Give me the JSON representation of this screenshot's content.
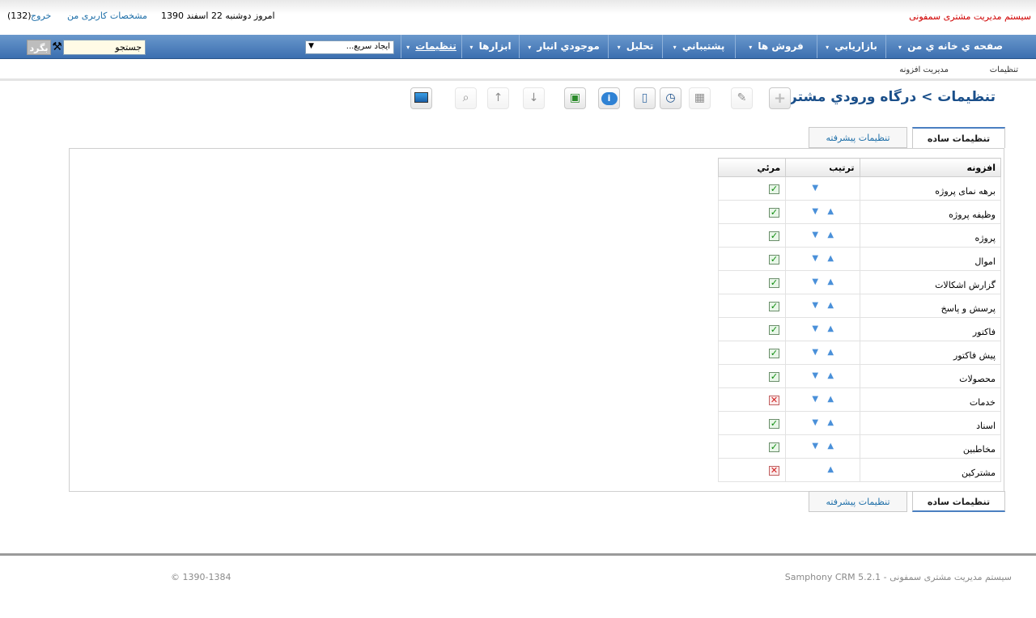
{
  "header": {
    "brand": "سیستم مدیریت مشتری سمفونی",
    "date": "امروز دوشنبه 22 اسفند 1390",
    "profile_link": "مشخصات کاربری من",
    "logout_link": "خروج",
    "count": "(132)"
  },
  "nav": {
    "items": [
      {
        "label": "صفحه ي خانه ي من",
        "caret": "▾"
      },
      {
        "label": "بازاريابي",
        "caret": "▾"
      },
      {
        "label": "فروش ها",
        "caret": "▾"
      },
      {
        "label": "پشتيباني",
        "caret": "▾"
      },
      {
        "label": "تحليل",
        "caret": "▾"
      },
      {
        "label": "موجودي انبار",
        "caret": "▾"
      },
      {
        "label": "ابزارها",
        "caret": "▾"
      },
      {
        "label": "تنظيمات",
        "caret": "▾"
      }
    ],
    "quick_create": "ايجاد سريع...",
    "search_placeholder": "جستجو",
    "search_button": "بگرد"
  },
  "subnav": {
    "settings": "تنظیمات",
    "module_manager": "مدیریت افزونه"
  },
  "page": {
    "title": "تنظيمات > درگاه ورودي مشتري"
  },
  "toolbar": {
    "icons": [
      "monitor-icon",
      "search-preview-icon",
      "move-up-icon",
      "move-down-icon",
      "clipboard-icon",
      "info-icon",
      "calculator-icon",
      "clock-icon",
      "calendar-icon",
      "edit-icon",
      "add-icon"
    ]
  },
  "tabs": {
    "simple": "تنظیمات ساده",
    "advanced": "تنظیمات پیشرفته"
  },
  "table": {
    "headers": {
      "module": "افزونه",
      "order": "ترتیب",
      "visible": "مرئي"
    },
    "rows": [
      {
        "name": "برهه نمای پروژه",
        "up": false,
        "down": true,
        "visible": true
      },
      {
        "name": "وظیفه پروژه",
        "up": true,
        "down": true,
        "visible": true
      },
      {
        "name": "پروژه",
        "up": true,
        "down": true,
        "visible": true
      },
      {
        "name": "اموال",
        "up": true,
        "down": true,
        "visible": true
      },
      {
        "name": "گزارش اشکالات",
        "up": true,
        "down": true,
        "visible": true
      },
      {
        "name": "پرسش و پاسخ",
        "up": true,
        "down": true,
        "visible": true
      },
      {
        "name": "فاکتور",
        "up": true,
        "down": true,
        "visible": true
      },
      {
        "name": "پیش فاکتور",
        "up": true,
        "down": true,
        "visible": true
      },
      {
        "name": "محصولات",
        "up": true,
        "down": true,
        "visible": true
      },
      {
        "name": "خدمات",
        "up": true,
        "down": true,
        "visible": false
      },
      {
        "name": "اسناد",
        "up": true,
        "down": true,
        "visible": true
      },
      {
        "name": "مخاطبین",
        "up": true,
        "down": true,
        "visible": true
      },
      {
        "name": "مشترکین",
        "up": true,
        "down": false,
        "visible": false
      }
    ]
  },
  "footer": {
    "product": "Samphony CRM 5.2.1 - سیستم مدیریت مشتری سمفونی",
    "copyright": "© 1390-1384"
  },
  "colors": {
    "nav_bar": "#4a7fc1",
    "brand_red": "#d00000",
    "title_blue": "#1a4f8a",
    "link_blue": "#1d6ea8"
  }
}
